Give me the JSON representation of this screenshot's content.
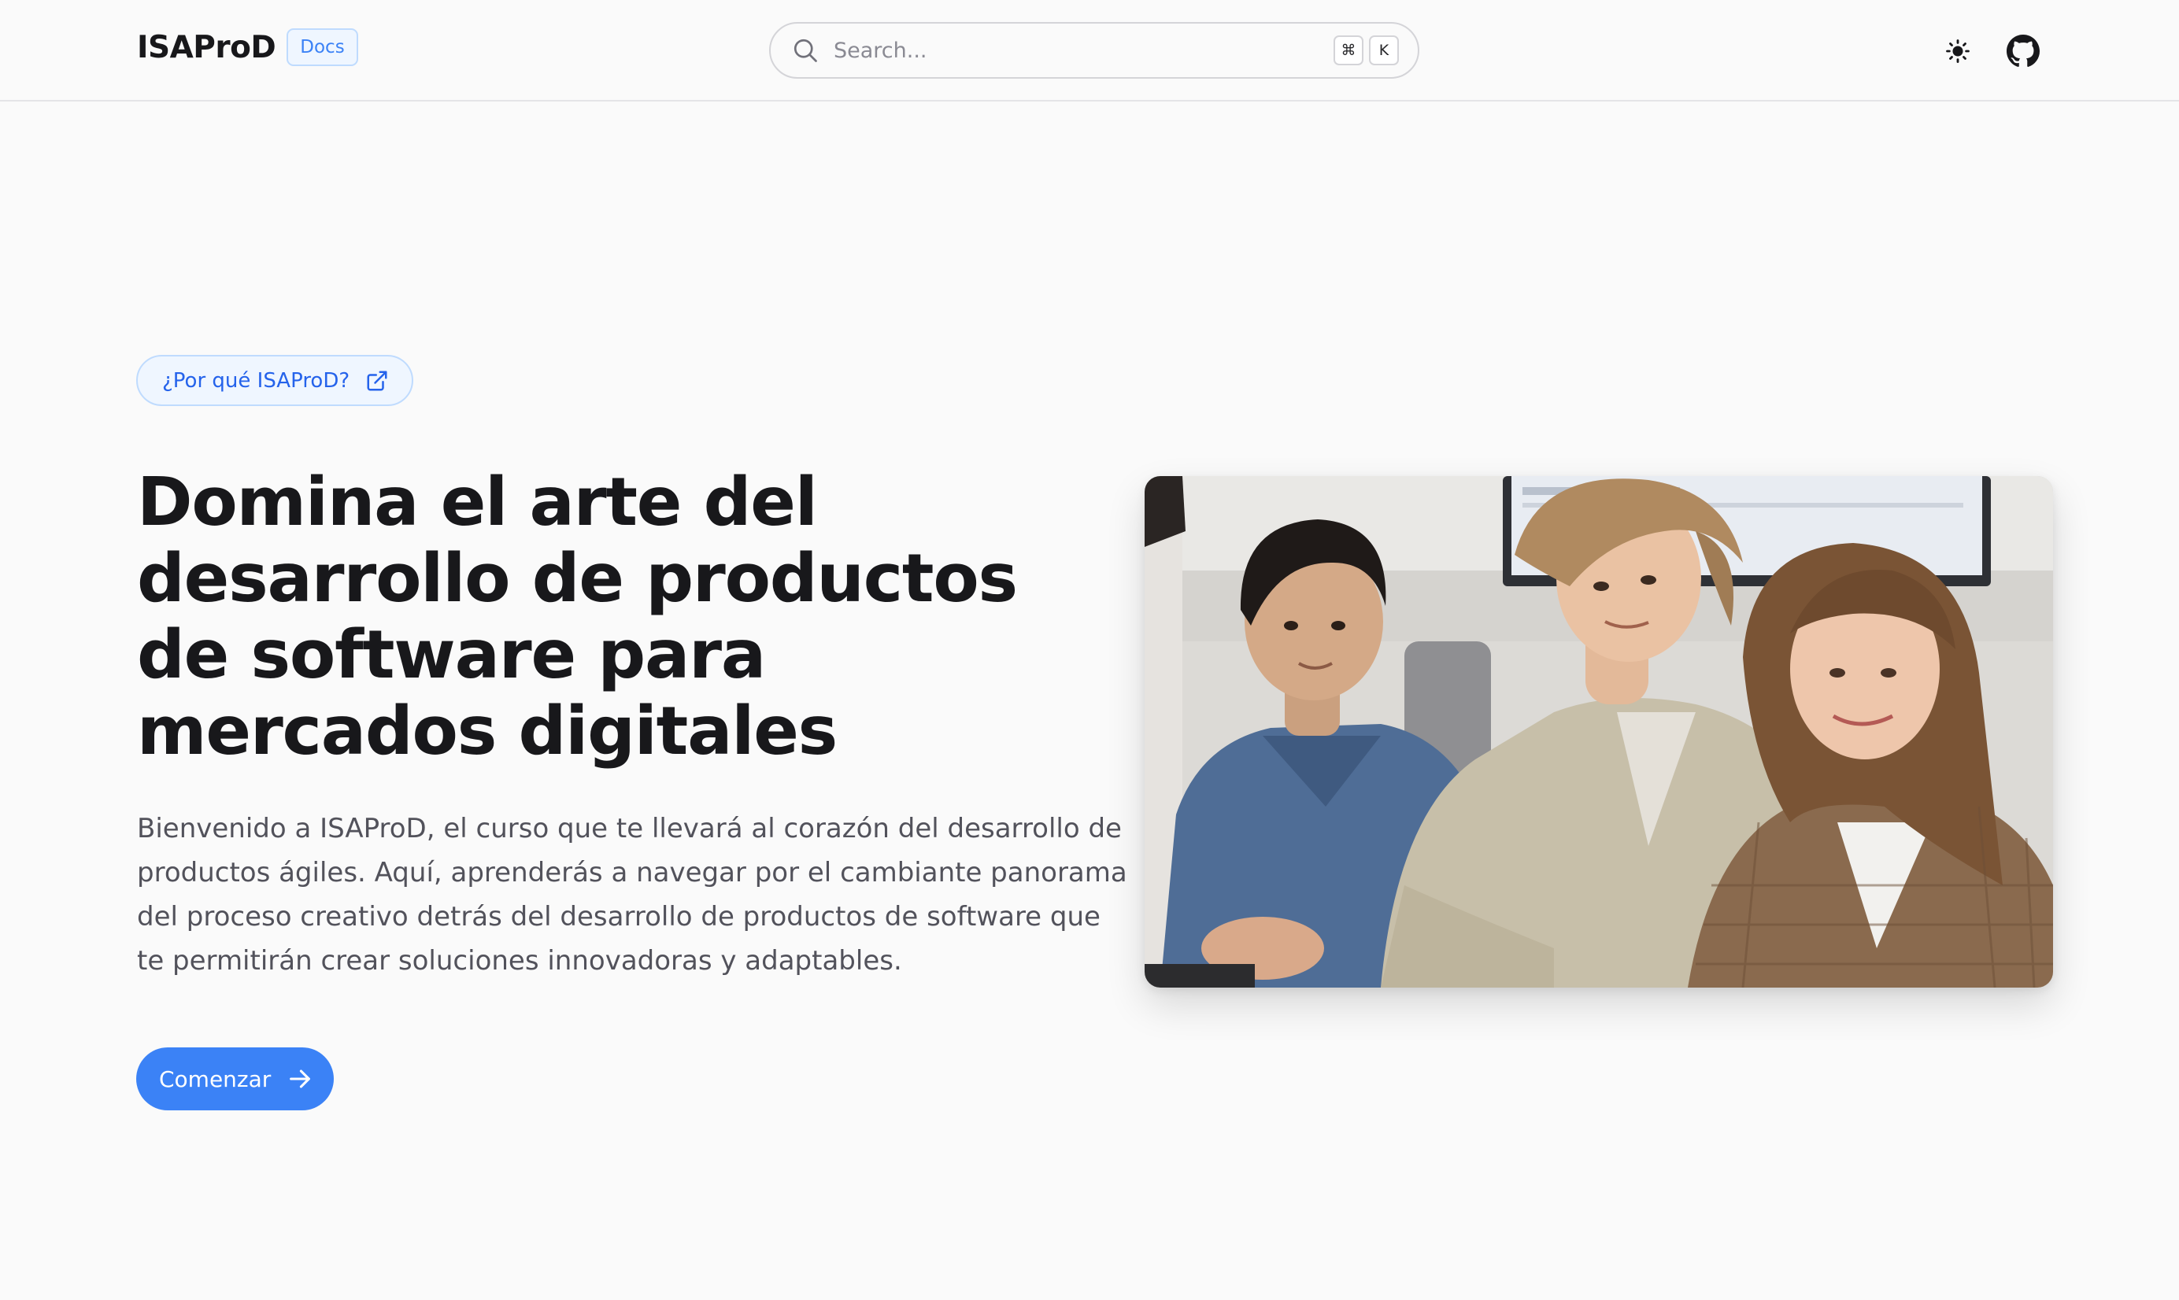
{
  "header": {
    "brand": "ISAProD",
    "badge": "Docs",
    "search": {
      "placeholder": "Search...",
      "shortcut_keys": [
        "⌘",
        "K"
      ]
    },
    "icons": {
      "theme": "sun-icon",
      "repo": "github-icon"
    }
  },
  "hero": {
    "pill_label": "¿Por qué ISAProD?",
    "title_lines": [
      "Domina el arte del",
      "desarrollo de productos",
      "de software para",
      "mercados digitales"
    ],
    "description_lines": [
      "Bienvenido a ISAProD, el curso que te llevará al corazón del desarrollo de",
      "productos ágiles. Aquí, aprenderás a navegar por el cambiante panorama",
      "del proceso creativo detrás del desarrollo de productos de software que",
      "te permitirán crear soluciones innovadoras y adaptables."
    ],
    "cta_label": "Comenzar"
  },
  "colors": {
    "accent": "#3b82f6",
    "background": "#fafafa",
    "text": "#18181b",
    "muted_text": "#52525b"
  }
}
